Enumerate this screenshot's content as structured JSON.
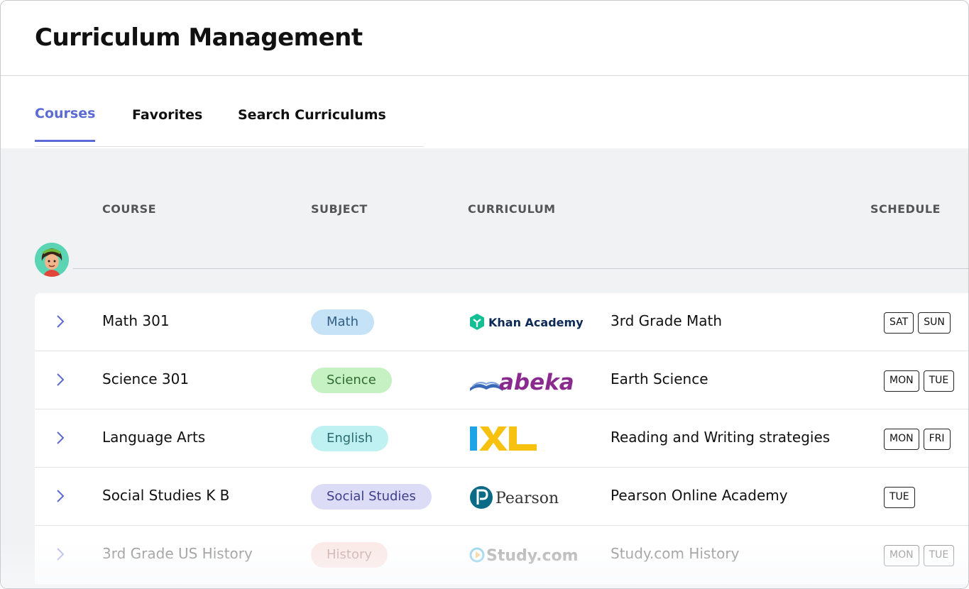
{
  "header": {
    "title": "Curriculum Management"
  },
  "tabs": [
    {
      "label": "Courses",
      "active": true
    },
    {
      "label": "Favorites",
      "active": false
    },
    {
      "label": "Search Curriculums",
      "active": false
    }
  ],
  "table": {
    "columns": {
      "course": "COURSE",
      "subject": "SUBJECT",
      "curriculum": "CURRICULUM",
      "schedule": "SCHEDULE"
    },
    "rows": [
      {
        "course": "Math 301",
        "subject": "Math",
        "subject_bg": "#c6e2f6",
        "subject_color": "#2f5f86",
        "provider": "Khan Academy",
        "curriculum": "3rd Grade Math",
        "days": [
          "SAT",
          "SUN"
        ]
      },
      {
        "course": "Science 301",
        "subject": "Science",
        "subject_bg": "#c5f1c3",
        "subject_color": "#2f6b30",
        "provider": "abeka",
        "curriculum": "Earth Science",
        "days": [
          "MON",
          "TUE"
        ]
      },
      {
        "course": "Language Arts",
        "subject": "English",
        "subject_bg": "#bff1f2",
        "subject_color": "#2b6c70",
        "provider": "IXL",
        "curriculum": "Reading and Writing strategies",
        "days": [
          "MON",
          "FRI"
        ]
      },
      {
        "course": "Social Studies K B",
        "subject": "Social Studies",
        "subject_bg": "#dcdcf6",
        "subject_color": "#3d3f8a",
        "provider": "Pearson",
        "curriculum": "Pearson Online Academy",
        "days": [
          "TUE"
        ]
      },
      {
        "course": "3rd Grade US History",
        "subject": "History",
        "subject_bg": "#f8cfc9",
        "subject_color": "#8a4a42",
        "provider": "Study.com",
        "curriculum": "Study.com History",
        "days": [
          "MON",
          "TUE"
        ]
      }
    ]
  },
  "colors": {
    "accent": "#5b6bd3",
    "khan": "#14bf96",
    "abeka": "#8a2a8f",
    "ixl_blue": "#1da3e6",
    "ixl_yellow": "#f6c20f",
    "pearson": "#0b6b87"
  }
}
